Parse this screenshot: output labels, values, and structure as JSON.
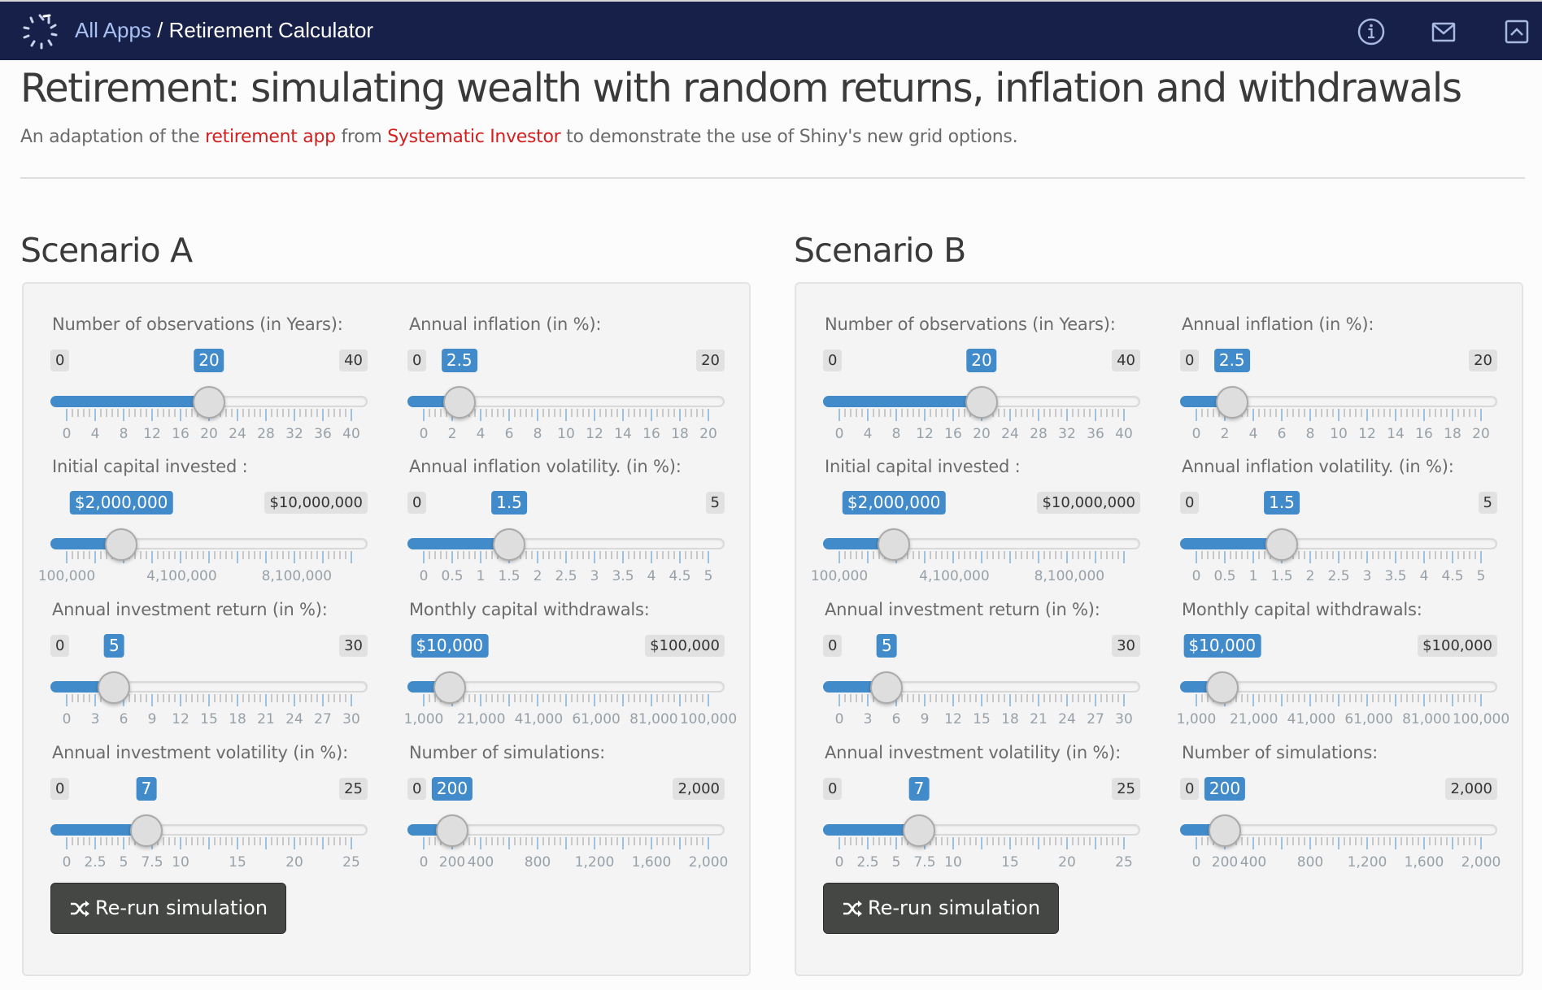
{
  "navbar": {
    "crumb": "All Apps",
    "separator": " / ",
    "app_title": "Retirement Calculator",
    "icons": [
      "info-icon",
      "mail-icon",
      "collapse-icon"
    ]
  },
  "header": {
    "title": "Retirement: simulating wealth with random returns, inflation and withdrawals",
    "subtitle_pre": "An adaptation of the ",
    "link1": "retirement app",
    "subtitle_mid": " from ",
    "link2": "Systematic Investor",
    "subtitle_post": " to demonstrate the use of Shiny's new grid options."
  },
  "colors": {
    "navbar": "#162049",
    "accent": "#428bca",
    "link": "#d21f1f",
    "button": "#454745"
  },
  "scenarios": [
    {
      "title": "Scenario A",
      "button_label": "Re-run simulation",
      "sliders": [
        {
          "id": "n_obs",
          "label": "Number of observations (in Years):",
          "min": 0,
          "max": 40,
          "value": 20,
          "min_label": "0",
          "max_label": "40",
          "value_label": "20",
          "ticks": [
            "0",
            "4",
            "8",
            "12",
            "16",
            "20",
            "24",
            "28",
            "32",
            "36",
            "40"
          ]
        },
        {
          "id": "initial_capital",
          "label": "Initial capital invested :",
          "min": 100000,
          "max": 10000000,
          "value": 2000000,
          "min_label": "",
          "max_label": "$10,000,000",
          "value_label": "$2,000,000",
          "ticks": [
            "100,000",
            "4,100,000",
            "8,100,000"
          ]
        },
        {
          "id": "annual_return",
          "label": "Annual investment return (in %):",
          "min": 0,
          "max": 30,
          "value": 5,
          "min_label": "0",
          "max_label": "30",
          "value_label": "5",
          "ticks": [
            "0",
            "3",
            "6",
            "9",
            "12",
            "15",
            "18",
            "21",
            "24",
            "27",
            "30"
          ]
        },
        {
          "id": "annual_volatility",
          "label": "Annual investment volatility (in %):",
          "min": 0,
          "max": 25,
          "value": 7,
          "min_label": "0",
          "max_label": "25",
          "value_label": "7",
          "ticks": [
            "0",
            "2.5",
            "5",
            "7.5",
            "10",
            "15",
            "20",
            "25"
          ]
        },
        {
          "id": "annual_inflation",
          "label": "Annual inflation (in %):",
          "min": 0,
          "max": 20,
          "value": 2.5,
          "min_label": "0",
          "max_label": "20",
          "value_label": "2.5",
          "ticks": [
            "0",
            "2",
            "4",
            "6",
            "8",
            "10",
            "12",
            "14",
            "16",
            "18",
            "20"
          ]
        },
        {
          "id": "inflation_volatility",
          "label": "Annual inflation volatility. (in %):",
          "min": 0,
          "max": 5,
          "value": 1.5,
          "min_label": "0",
          "max_label": "5",
          "value_label": "1.5",
          "ticks": [
            "0",
            "0.5",
            "1",
            "1.5",
            "2",
            "2.5",
            "3",
            "3.5",
            "4",
            "4.5",
            "5"
          ]
        },
        {
          "id": "monthly_withdrawals",
          "label": "Monthly capital withdrawals:",
          "min": 1000,
          "max": 100000,
          "value": 10000,
          "min_label": "",
          "max_label": "$100,000",
          "value_label": "$10,000",
          "ticks": [
            "1,000",
            "21,000",
            "41,000",
            "61,000",
            "81,000",
            "100,000"
          ]
        },
        {
          "id": "n_sim",
          "label": "Number of simulations:",
          "min": 0,
          "max": 2000,
          "value": 200,
          "min_label": "0",
          "max_label": "2,000",
          "value_label": "200",
          "ticks": [
            "0",
            "200",
            "400",
            "800",
            "1,200",
            "1,600",
            "2,000"
          ]
        }
      ]
    },
    {
      "title": "Scenario B",
      "button_label": "Re-run simulation",
      "sliders": [
        {
          "id": "n_obs",
          "label": "Number of observations (in Years):",
          "min": 0,
          "max": 40,
          "value": 20,
          "min_label": "0",
          "max_label": "40",
          "value_label": "20",
          "ticks": [
            "0",
            "4",
            "8",
            "12",
            "16",
            "20",
            "24",
            "28",
            "32",
            "36",
            "40"
          ]
        },
        {
          "id": "initial_capital",
          "label": "Initial capital invested :",
          "min": 100000,
          "max": 10000000,
          "value": 2000000,
          "min_label": "",
          "max_label": "$10,000,000",
          "value_label": "$2,000,000",
          "ticks": [
            "100,000",
            "4,100,000",
            "8,100,000"
          ]
        },
        {
          "id": "annual_return",
          "label": "Annual investment return (in %):",
          "min": 0,
          "max": 30,
          "value": 5,
          "min_label": "0",
          "max_label": "30",
          "value_label": "5",
          "ticks": [
            "0",
            "3",
            "6",
            "9",
            "12",
            "15",
            "18",
            "21",
            "24",
            "27",
            "30"
          ]
        },
        {
          "id": "annual_volatility",
          "label": "Annual investment volatility (in %):",
          "min": 0,
          "max": 25,
          "value": 7,
          "min_label": "0",
          "max_label": "25",
          "value_label": "7",
          "ticks": [
            "0",
            "2.5",
            "5",
            "7.5",
            "10",
            "15",
            "20",
            "25"
          ]
        },
        {
          "id": "annual_inflation",
          "label": "Annual inflation (in %):",
          "min": 0,
          "max": 20,
          "value": 2.5,
          "min_label": "0",
          "max_label": "20",
          "value_label": "2.5",
          "ticks": [
            "0",
            "2",
            "4",
            "6",
            "8",
            "10",
            "12",
            "14",
            "16",
            "18",
            "20"
          ]
        },
        {
          "id": "inflation_volatility",
          "label": "Annual inflation volatility. (in %):",
          "min": 0,
          "max": 5,
          "value": 1.5,
          "min_label": "0",
          "max_label": "5",
          "value_label": "1.5",
          "ticks": [
            "0",
            "0.5",
            "1",
            "1.5",
            "2",
            "2.5",
            "3",
            "3.5",
            "4",
            "4.5",
            "5"
          ]
        },
        {
          "id": "monthly_withdrawals",
          "label": "Monthly capital withdrawals:",
          "min": 1000,
          "max": 100000,
          "value": 10000,
          "min_label": "",
          "max_label": "$100,000",
          "value_label": "$10,000",
          "ticks": [
            "1,000",
            "21,000",
            "41,000",
            "61,000",
            "81,000",
            "100,000"
          ]
        },
        {
          "id": "n_sim",
          "label": "Number of simulations:",
          "min": 0,
          "max": 2000,
          "value": 200,
          "min_label": "0",
          "max_label": "2,000",
          "value_label": "200",
          "ticks": [
            "0",
            "200",
            "400",
            "800",
            "1,200",
            "1,600",
            "2,000"
          ]
        }
      ]
    }
  ]
}
